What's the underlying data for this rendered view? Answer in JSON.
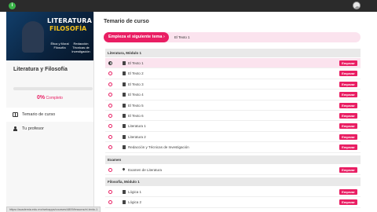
{
  "topbar": {
    "logo": "i"
  },
  "banner": {
    "title1": "LITERATURA",
    "title2": "FILOSOFÍA",
    "sub1": "Ética y Moral Filosofía",
    "sub2": "Redacción Técnicas de Investigación"
  },
  "sidebar": {
    "course_title": "Literatura y Filosofía",
    "progress": {
      "value": 0,
      "percent_label": "0%",
      "suffix": "Completo"
    },
    "nav": [
      {
        "label": "Temario de curso",
        "icon": "book-icon",
        "active": true
      },
      {
        "label": "Tu profesor",
        "icon": "user-icon",
        "active": false
      }
    ]
  },
  "main": {
    "title": "Temario de curso",
    "next": {
      "button": "Empieza el siguiente tema ›",
      "lesson": "El Texto 1"
    },
    "start_label": "Empezar",
    "sections": [
      {
        "title": "Literatura, Módulo 1",
        "lessons": [
          {
            "label": "El Texto 1",
            "status": "current",
            "icon": "document-icon"
          },
          {
            "label": "El Texto 2",
            "status": "open",
            "icon": "document-icon"
          },
          {
            "label": "El Texto 3",
            "status": "open",
            "icon": "document-icon"
          },
          {
            "label": "El Texto 4",
            "status": "open",
            "icon": "document-icon"
          },
          {
            "label": "El Texto 5",
            "status": "open",
            "icon": "document-icon"
          },
          {
            "label": "El Texto 6",
            "status": "open",
            "icon": "document-icon"
          },
          {
            "label": "Literatura 1",
            "status": "open",
            "icon": "document-icon"
          },
          {
            "label": "Literatura 2",
            "status": "open",
            "icon": "document-icon"
          },
          {
            "label": "Redacción y Técnicas de Investigación",
            "status": "open",
            "icon": "document-icon"
          }
        ]
      },
      {
        "title": "Examen",
        "lessons": [
          {
            "label": "Examen de Literatura",
            "status": "open",
            "icon": "pin-icon"
          }
        ]
      },
      {
        "title": "Filosofía, Módulo 1",
        "lessons": [
          {
            "label": "Lógica 1",
            "status": "open",
            "icon": "document-icon"
          },
          {
            "label": "Lógica 2",
            "status": "open",
            "icon": "document-icon"
          }
        ]
      }
    ]
  },
  "status_bar": {
    "url": "https://academia.edu.mx/webapps/courses/4809/lessons/el-texto-1"
  },
  "colors": {
    "accent": "#e91e63",
    "accent_light": "#fbe3ee",
    "topbar": "#2b2b2b",
    "sidebar": "#f7f7f7",
    "section_header": "#e9e9e9"
  }
}
